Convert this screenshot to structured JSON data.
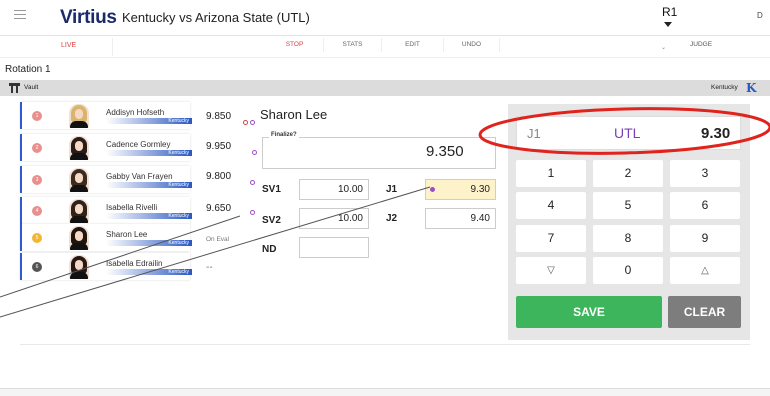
{
  "header": {
    "logo": "Virtius",
    "meet_title": "Kentucky vs Arizona State (UTL)",
    "rotation_selector": "R1",
    "user_initial": "D"
  },
  "toolbar": {
    "live": "LIVE",
    "stop": "STOP",
    "stats": "STATS",
    "edit": "EDIT",
    "undo": "UNDO",
    "judge_label": "JUDGE"
  },
  "rotation": {
    "title": "Rotation 1",
    "apparatus": "Vault",
    "team": "Kentucky",
    "team_logo": "K"
  },
  "athletes": [
    {
      "order": "1",
      "name": "Addisyn Hofseth",
      "team": "Kentucky",
      "score": "9.850"
    },
    {
      "order": "2",
      "name": "Cadence Gormley",
      "team": "Kentucky",
      "score": "9.950"
    },
    {
      "order": "3",
      "name": "Gabby Van Frayen",
      "team": "Kentucky",
      "score": "9.800"
    },
    {
      "order": "4",
      "name": "Isabella Rivelli",
      "team": "Kentucky",
      "score": "9.650"
    },
    {
      "order": "5",
      "name": "Sharon Lee",
      "team": "Kentucky",
      "score": "On Eval"
    },
    {
      "order": "6",
      "name": "Isabella Edrailin",
      "team": "Kentucky",
      "score": "--"
    }
  ],
  "scoring": {
    "athlete_name": "Sharon Lee",
    "finalize_label": "Finalize?",
    "final_score": "9.350",
    "sv1_label": "SV1",
    "sv1_value": "10.00",
    "sv2_label": "SV2",
    "sv2_value": "10.00",
    "j1_label": "J1",
    "j1_value": "9.30",
    "j2_label": "J2",
    "j2_value": "9.40",
    "nd_label": "ND",
    "nd_value": ""
  },
  "keypad": {
    "display_judge": "J1",
    "display_event": "UTL",
    "display_value": "9.30",
    "keys": [
      "1",
      "2",
      "3",
      "4",
      "5",
      "6",
      "7",
      "8",
      "9",
      "▽",
      "0",
      "△"
    ],
    "save_label": "SAVE",
    "clear_label": "CLEAR"
  },
  "colors": {
    "brand_blue": "#2a58c2",
    "accent_purple": "#7a3fbb",
    "save_green": "#3db55c",
    "annotation_red": "#e0231c"
  }
}
